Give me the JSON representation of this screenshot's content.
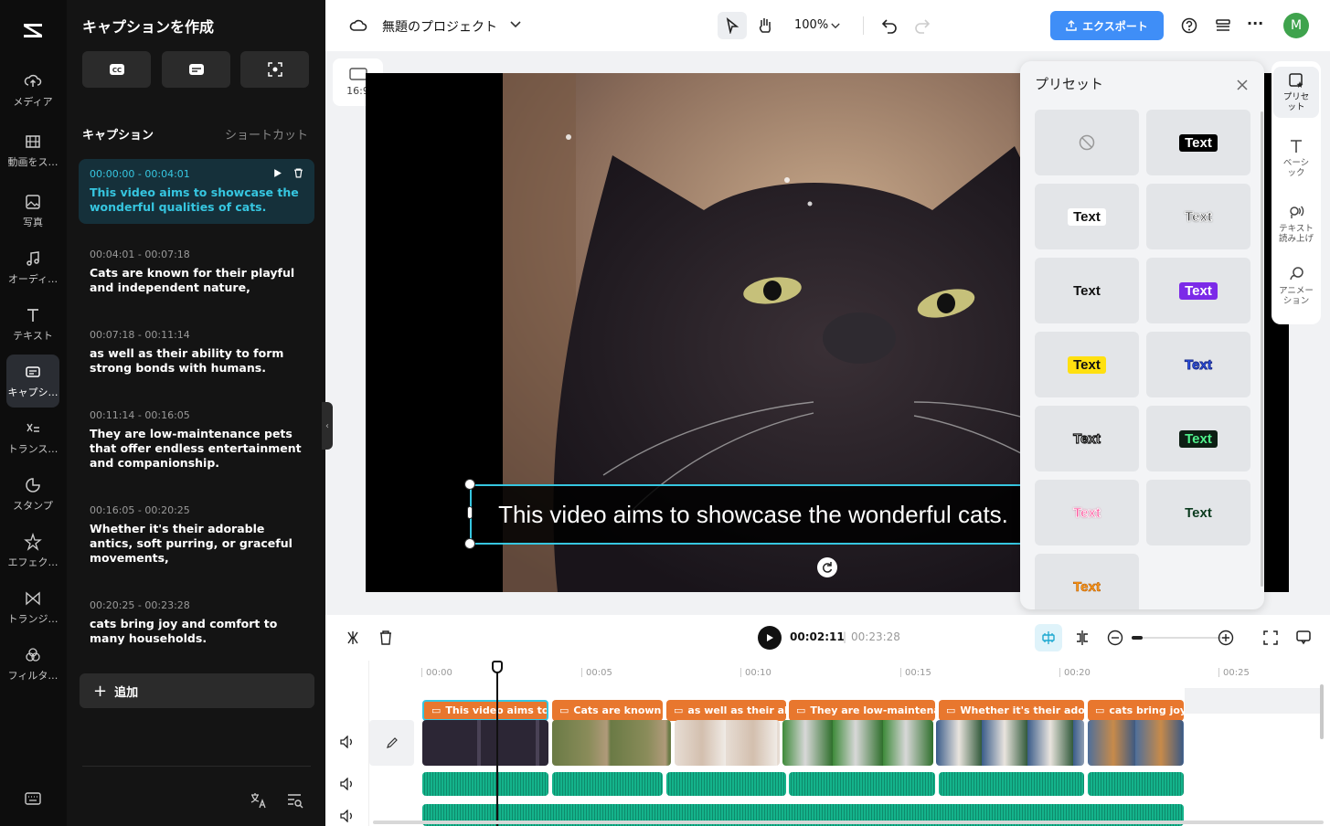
{
  "rail": {
    "items": [
      {
        "label": "メディア",
        "icon": "cloud-upload-icon"
      },
      {
        "label": "動画をス…",
        "icon": "film-icon"
      },
      {
        "label": "写真",
        "icon": "image-icon"
      },
      {
        "label": "オーディ…",
        "icon": "music-icon"
      },
      {
        "label": "テキスト",
        "icon": "text-icon"
      },
      {
        "label": "キャプシ…",
        "icon": "captions-icon"
      },
      {
        "label": "トランス…",
        "icon": "transcript-icon"
      },
      {
        "label": "スタンプ",
        "icon": "sticker-icon"
      },
      {
        "label": "エフェク…",
        "icon": "effects-icon"
      },
      {
        "label": "トランジ…",
        "icon": "transition-icon"
      },
      {
        "label": "フィルタ…",
        "icon": "filter-icon"
      }
    ]
  },
  "captionPanel": {
    "title": "キャプションを作成",
    "section": "キャプション",
    "shortcut": "ショートカット",
    "add": "追加",
    "items": [
      {
        "time": "00:00:00 - 00:04:01",
        "text": "This video aims to showcase the wonderful qualities of cats."
      },
      {
        "time": "00:04:01 - 00:07:18",
        "text": "Cats are known for their playful and independent nature,"
      },
      {
        "time": "00:07:18 - 00:11:14",
        "text": "as well as their ability to form strong bonds with humans."
      },
      {
        "time": "00:11:14 - 00:16:05",
        "text": "They are low-maintenance pets that offer endless entertainment and companionship."
      },
      {
        "time": "00:16:05 - 00:20:25",
        "text": "Whether it's their adorable antics, soft purring, or graceful movements,"
      },
      {
        "time": "00:20:25 - 00:23:28",
        "text": "cats bring joy and comfort to many households."
      }
    ]
  },
  "topbar": {
    "project": "無題のプロジェクト",
    "zoom": "100%",
    "export": "エクスポート",
    "avatar": "M"
  },
  "canvas": {
    "ratio": "16:9",
    "subtitle": "This video aims to showcase the wonderful cats."
  },
  "presets": {
    "title": "プリセット",
    "sample": "Text"
  },
  "sideTabs": [
    {
      "label": "プリセット"
    },
    {
      "label": "ベーシック"
    },
    {
      "label": "テキスト読み上げ"
    },
    {
      "label": "アニメーション"
    }
  ],
  "playback": {
    "current": "00:02:11",
    "total": "00:23:28"
  },
  "timeline": {
    "ruler": [
      "00:00",
      "00:05",
      "00:10",
      "00:15",
      "00:20",
      "00:25"
    ],
    "captionClips": [
      "This video aims to",
      "Cats are known",
      "as well as their ab",
      "They are low-maintena",
      "Whether it's their adora",
      "cats bring joy"
    ]
  },
  "colors": {
    "accent": "#36c6e0",
    "export": "#3f8ef7",
    "captionClip": "#e8772e",
    "audioClip": "#14b38b"
  }
}
